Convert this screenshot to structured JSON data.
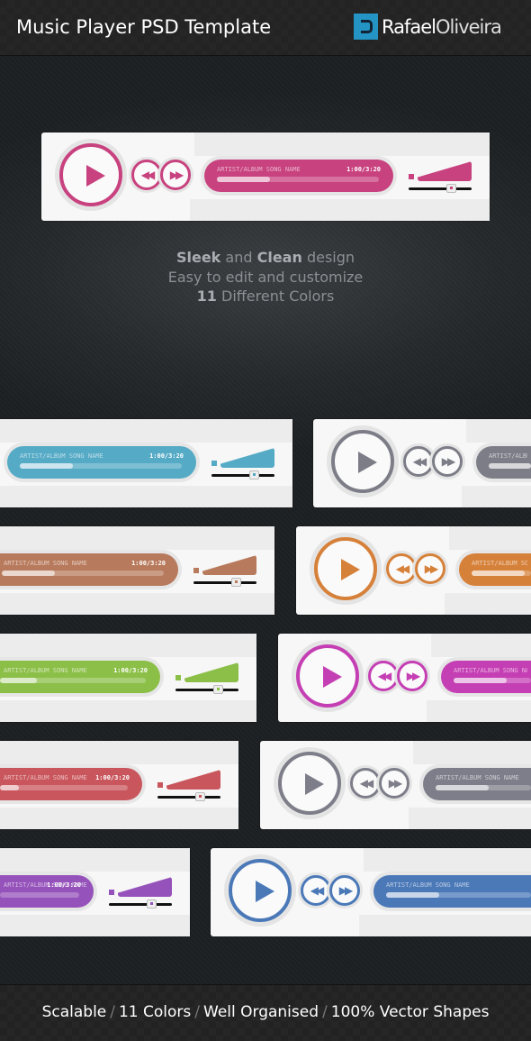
{
  "header": {
    "title": "Music Player PSD Template",
    "logo_first": "Rafael",
    "logo_second": "Oliveira"
  },
  "tagline": {
    "line1_bold1": "Sleek",
    "line1_mid": " and ",
    "line1_bold2": "Clean",
    "line1_end": " design",
    "line2": "Easy to edit and customize",
    "line3_bold": "11",
    "line3_end": " Different Colors"
  },
  "player_text": {
    "meta": "ARTIST/ALBUM  SONG NAME",
    "time": "1:00/3:20",
    "rewind": "◀◀",
    "forward": "▶▶"
  },
  "progress_percent": 33,
  "volume_percent": 70,
  "players": [
    {
      "color": "#c8427f"
    },
    {
      "color": "#55aac6"
    },
    {
      "color": "#7d7d88"
    },
    {
      "color": "#b87a5c"
    },
    {
      "color": "#d6813a"
    },
    {
      "color": "#8cbf48"
    },
    {
      "color": "#c53fb4"
    },
    {
      "color": "#c8565c"
    },
    {
      "color": "#7e7e8a"
    },
    {
      "color": "#9552ba"
    },
    {
      "color": "#4b79b8"
    }
  ],
  "footer": {
    "items": [
      "Scalable",
      "11 Colors",
      "Well Organised",
      "100% Vector Shapes"
    ],
    "separator": "/"
  }
}
